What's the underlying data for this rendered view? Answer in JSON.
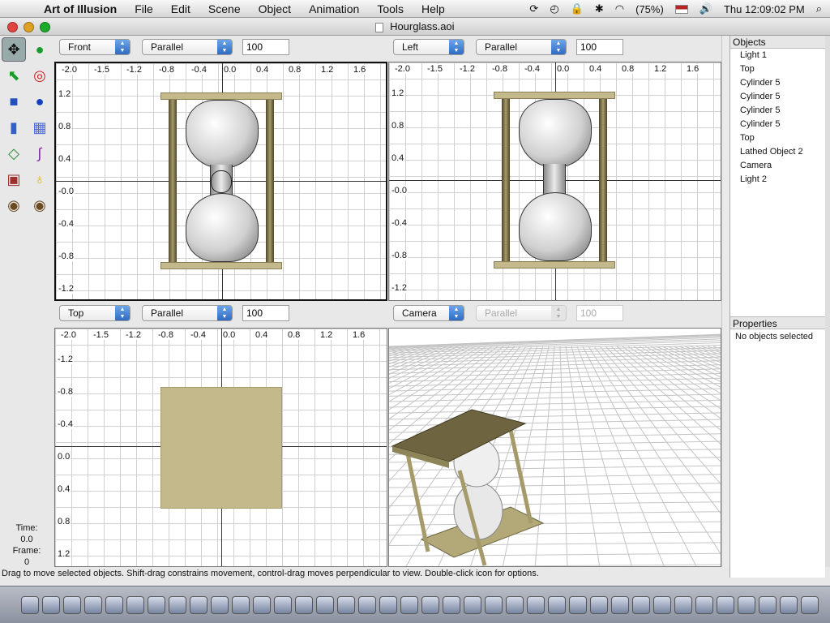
{
  "menubar": {
    "apple_icon": "apple-icon",
    "app_name": "Art of Illusion",
    "items": [
      "File",
      "Edit",
      "Scene",
      "Object",
      "Animation",
      "Tools",
      "Help"
    ],
    "battery": "(75%)",
    "clock": "Thu 12:09:02 PM"
  },
  "window": {
    "title": "Hourglass.aoi"
  },
  "viewports": {
    "front": {
      "view": "Front",
      "projection": "Parallel",
      "scale": "100"
    },
    "left": {
      "view": "Left",
      "projection": "Parallel",
      "scale": "100"
    },
    "top": {
      "view": "Top",
      "projection": "Parallel",
      "scale": "100"
    },
    "camera": {
      "view": "Camera",
      "projection": "Parallel",
      "scale": "100"
    }
  },
  "ruler_x": [
    "-2.0",
    "-1.6",
    "-1.2",
    "-0.8",
    "-0.4",
    "0.0",
    "0.4",
    "0.8",
    "1.2",
    "1.6"
  ],
  "ruler_x_ticks_front": [
    "-2.0",
    "-1.5",
    "-1.2",
    "-0.8",
    "-0.4",
    "0.0",
    "0.4",
    "0.8",
    "1.2",
    "1.6"
  ],
  "ruler_y_front": [
    "1.2",
    "0.8",
    "0.4",
    "-0.0",
    "-0.4",
    "-0.8",
    "-1.2"
  ],
  "ruler_y_top": [
    "-1.2",
    "-0.8",
    "-0.4",
    "0.0",
    "0.4",
    "0.8",
    "1.2"
  ],
  "objects_panel": {
    "title": "Objects",
    "items": [
      "Light 1",
      "Top",
      "Cylinder 5",
      "Cylinder 5",
      "Cylinder 5",
      "Cylinder 5",
      "Top",
      "Lathed Object 2",
      "Camera",
      "Light 2"
    ]
  },
  "properties_panel": {
    "title": "Properties",
    "message": "No objects selected"
  },
  "time_panel": {
    "time_label": "Time:",
    "time_value": "0.0",
    "frame_label": "Frame:",
    "frame_value": "0"
  },
  "status_text": "Drag to move selected objects.  Shift-drag constrains movement, control-drag moves perpendicular to view.  Double-click icon for options.",
  "colors": {
    "frame_tan": "#c3b98a",
    "post_dark": "#6e6440",
    "selection_blue": "#3477d6"
  }
}
